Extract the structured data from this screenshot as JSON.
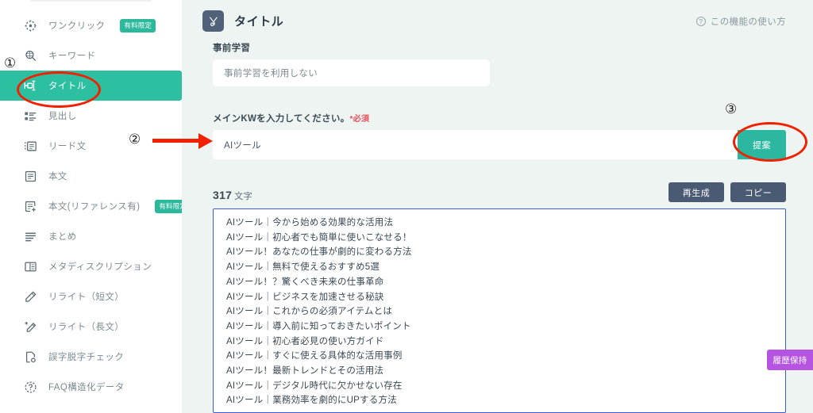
{
  "sidebar": {
    "items": [
      {
        "label": "ワンクリック",
        "icon": "one-click-icon",
        "badge": "有料限定",
        "active": false
      },
      {
        "label": "キーワード",
        "icon": "keyword-search-icon",
        "badge": "",
        "active": false
      },
      {
        "label": "タイトル",
        "icon": "title-icon",
        "badge": "",
        "active": true
      },
      {
        "label": "見出し",
        "icon": "heading-list-icon",
        "badge": "",
        "active": false
      },
      {
        "label": "リード文",
        "icon": "lead-text-icon",
        "badge": "",
        "active": false
      },
      {
        "label": "本文",
        "icon": "body-text-icon",
        "badge": "",
        "active": false
      },
      {
        "label": "本文(リファレンス有)",
        "icon": "body-reference-icon",
        "badge": "有料限定",
        "active": false
      },
      {
        "label": "まとめ",
        "icon": "summary-lines-icon",
        "badge": "",
        "active": false
      },
      {
        "label": "メタディスクリプション",
        "icon": "meta-description-icon",
        "badge": "",
        "active": false
      },
      {
        "label": "リライト（短文）",
        "icon": "pencil-icon",
        "badge": "",
        "active": false
      },
      {
        "label": "リライト（長文）",
        "icon": "magic-pencil-icon",
        "badge": "",
        "active": false
      },
      {
        "label": "誤字脱字チェック",
        "icon": "proofread-document-icon",
        "badge": "",
        "active": false
      },
      {
        "label": "FAQ構造化データ",
        "icon": "faq-question-icon",
        "badge": "",
        "active": false
      }
    ]
  },
  "header": {
    "title": "タイトル",
    "icon": "title-tool-icon",
    "help_label": "この機能の使い方",
    "help_icon": "question-circle-icon"
  },
  "pretraining": {
    "label": "事前学習",
    "value": "事前学習を利用しない"
  },
  "main_kw": {
    "label": "メインKWを入力してください。",
    "required_mark": "*必須",
    "value": "AIツール",
    "submit_label": "提案"
  },
  "result": {
    "count": "317",
    "count_unit": "文字",
    "regenerate_label": "再生成",
    "copy_label": "コピー",
    "history_label": "履歴保持",
    "lines": [
      "AIツール｜今から始める効果的な活用法",
      "AIツール｜初心者でも簡単に使いこなせる！",
      "AIツール！あなたの仕事が劇的に変わる方法",
      "AIツール｜無料で使えるおすすめ5選",
      "AIツール！？驚くべき未来の仕事革命",
      "AIツール｜ビジネスを加速させる秘訣",
      "AIツール｜これからの必須アイテムとは",
      "AIツール｜導入前に知っておきたいポイント",
      "AIツール｜初心者必見の使い方ガイド",
      "AIツール｜すぐに使える具体的な活用事例",
      "AIツール！最新トレンドとその活用法",
      "AIツール｜デジタル時代に欠かせない存在",
      "AIツール｜業務効率を劇的にUPする方法"
    ]
  },
  "annotations": {
    "step1": "①",
    "step2": "②",
    "step3": "③"
  },
  "colors": {
    "accent_teal": "#2cb8a0",
    "active_nav": "#2cc0a0",
    "badge_paid": "#2cb89a",
    "main_bg": "#edf4f2",
    "dark_button": "#4a5a73",
    "history_purple": "#b554e0",
    "result_border": "#3b5bdb",
    "required_red": "#e8505b",
    "annotation_red": "#f02000"
  }
}
